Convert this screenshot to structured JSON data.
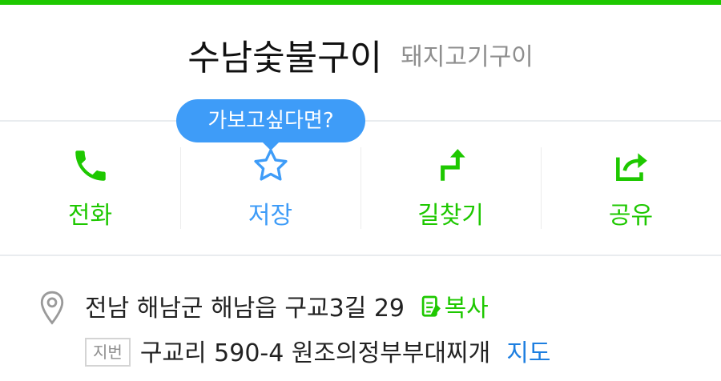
{
  "place": {
    "name": "수남숯불구이",
    "category": "돼지고기구이"
  },
  "tooltip": {
    "text": "가보고싶다면?"
  },
  "actions": [
    {
      "label": "전화",
      "icon": "phone-icon",
      "color": "#1ec800"
    },
    {
      "label": "저장",
      "icon": "star-icon",
      "color": "#3e9cf8"
    },
    {
      "label": "길찾기",
      "icon": "directions-icon",
      "color": "#1ec800"
    },
    {
      "label": "공유",
      "icon": "share-icon",
      "color": "#1ec800"
    }
  ],
  "address": {
    "road": "전남 해남군 해남읍 구교3길 29",
    "copy_label": "복사",
    "lot_badge": "지번",
    "lot": "구교리 590-4 원조의정부부대찌개",
    "map_label": "지도",
    "icon": "location-pin-icon"
  },
  "colors": {
    "accent": "#1ec800",
    "save_blue": "#3e9cf8",
    "link_blue": "#1e7fe0"
  }
}
